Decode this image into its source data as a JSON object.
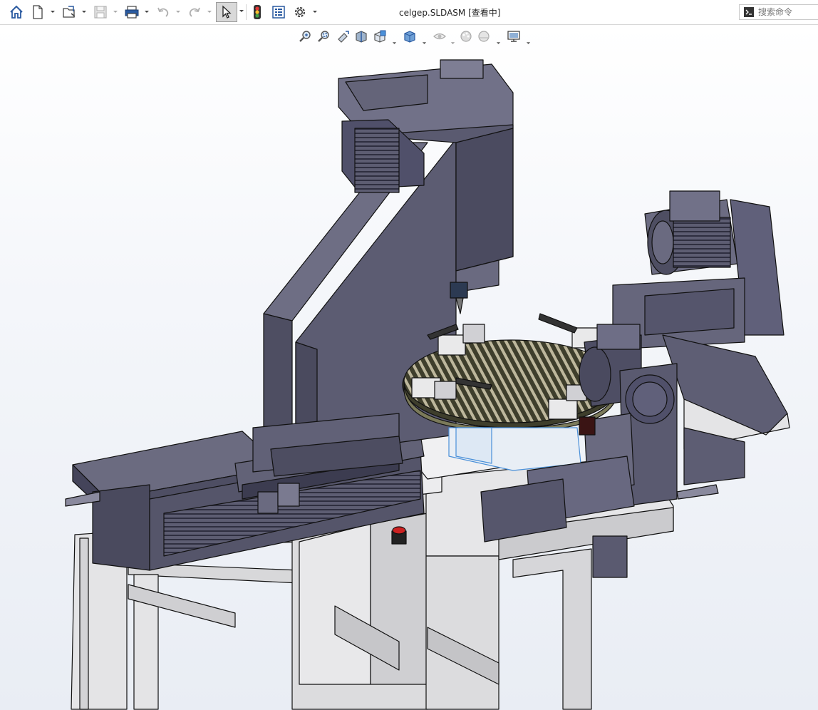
{
  "window": {
    "document_title": "celgep.SLDASM [查看中]"
  },
  "quick_access": {
    "items": [
      {
        "icon": "home-icon"
      },
      {
        "icon": "new-document-icon"
      },
      {
        "icon": "open-file-icon"
      },
      {
        "icon": "save-icon"
      },
      {
        "icon": "print-icon"
      },
      {
        "icon": "undo-icon"
      },
      {
        "icon": "redo-icon"
      },
      {
        "icon": "select-cursor-icon",
        "state": "active"
      },
      {
        "icon": "rebuild-traffic-light-icon"
      },
      {
        "icon": "file-properties-icon"
      },
      {
        "icon": "options-gear-icon"
      }
    ]
  },
  "search": {
    "placeholder": "搜索命令",
    "icon": "command-prompt-icon"
  },
  "view_toolbar": {
    "items": [
      {
        "icon": "zoom-to-fit-icon"
      },
      {
        "icon": "zoom-to-area-icon"
      },
      {
        "icon": "previous-view-icon"
      },
      {
        "icon": "section-view-icon"
      },
      {
        "icon": "view-orientation-icon"
      },
      {
        "icon": "display-style-icon"
      },
      {
        "icon": "hide-show-items-icon"
      },
      {
        "icon": "edit-appearance-icon"
      },
      {
        "icon": "apply-scene-icon"
      },
      {
        "icon": "view-settings-monitor-icon"
      }
    ]
  },
  "colors": {
    "machine_body": "#5a5a6e",
    "machine_dark": "#3f3f52",
    "machine_light": "#7a7a8e",
    "frame": "#e4e4e6",
    "table_top": "#4a4a36",
    "table_slats": "#b8b39a",
    "accent_red": "#cc2222",
    "accent_blue": "#4a90d9"
  }
}
